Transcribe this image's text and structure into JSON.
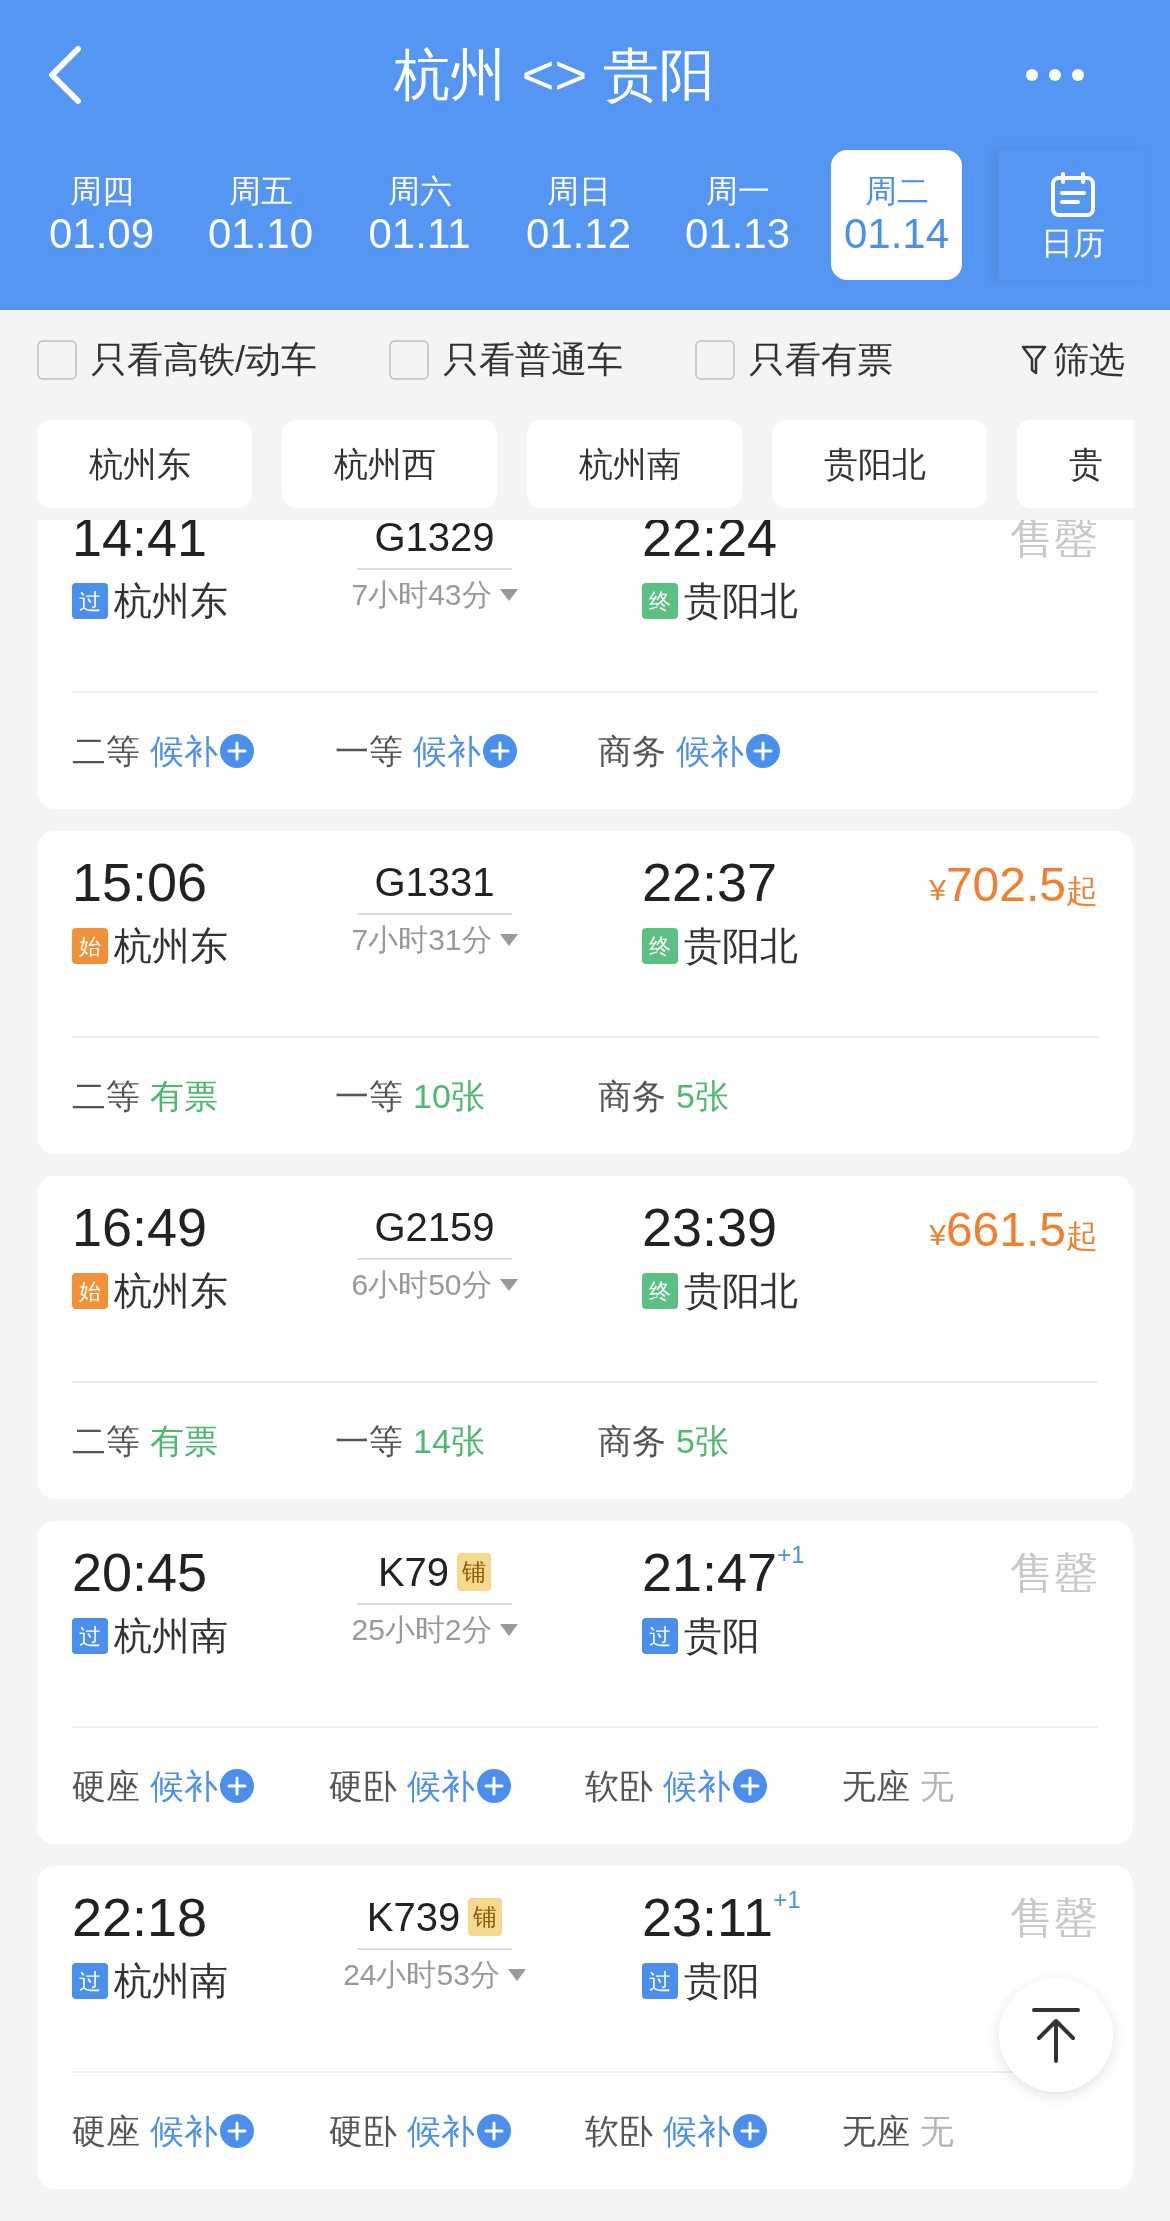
{
  "header": {
    "title": "杭州 <> 贵阳",
    "calendar_label": "日历"
  },
  "dates": [
    {
      "weekday": "周四",
      "date": "01.09",
      "selected": false
    },
    {
      "weekday": "周五",
      "date": "01.10",
      "selected": false
    },
    {
      "weekday": "周六",
      "date": "01.11",
      "selected": false
    },
    {
      "weekday": "周日",
      "date": "01.12",
      "selected": false
    },
    {
      "weekday": "周一",
      "date": "01.13",
      "selected": false
    },
    {
      "weekday": "周二",
      "date": "01.14",
      "selected": true
    }
  ],
  "filters": [
    {
      "label": "只看高铁/动车",
      "checked": false
    },
    {
      "label": "只看普通车",
      "checked": false
    },
    {
      "label": "只看有票",
      "checked": false
    }
  ],
  "filter_button": "筛选",
  "stations": [
    "杭州东",
    "杭州西",
    "杭州南",
    "贵阳北",
    "贵"
  ],
  "trains": [
    {
      "depart": "14:41",
      "train_no": "G1329",
      "duration": "7小时43分",
      "arrive": "22:24",
      "from": {
        "tag": "过",
        "kind": "pass",
        "name": "杭州东"
      },
      "to": {
        "tag": "终",
        "kind": "terminal",
        "name": "贵阳北"
      },
      "status": "售罄",
      "seats": [
        {
          "class": "二等",
          "availability": "候补",
          "kind": "waitlist"
        },
        {
          "class": "一等",
          "availability": "候补",
          "kind": "waitlist"
        },
        {
          "class": "商务",
          "availability": "候补",
          "kind": "waitlist"
        }
      ]
    },
    {
      "depart": "15:06",
      "train_no": "G1331",
      "duration": "7小时31分",
      "arrive": "22:37",
      "from": {
        "tag": "始",
        "kind": "origin",
        "name": "杭州东"
      },
      "to": {
        "tag": "终",
        "kind": "terminal",
        "name": "贵阳北"
      },
      "price": {
        "currency": "¥",
        "amount": "702.5",
        "suffix": "起"
      },
      "seats": [
        {
          "class": "二等",
          "availability": "有票",
          "kind": "available"
        },
        {
          "class": "一等",
          "availability": "10张",
          "kind": "available"
        },
        {
          "class": "商务",
          "availability": "5张",
          "kind": "available"
        }
      ]
    },
    {
      "depart": "16:49",
      "train_no": "G2159",
      "duration": "6小时50分",
      "arrive": "23:39",
      "from": {
        "tag": "始",
        "kind": "origin",
        "name": "杭州东"
      },
      "to": {
        "tag": "终",
        "kind": "terminal",
        "name": "贵阳北"
      },
      "price": {
        "currency": "¥",
        "amount": "661.5",
        "suffix": "起"
      },
      "seats": [
        {
          "class": "二等",
          "availability": "有票",
          "kind": "available"
        },
        {
          "class": "一等",
          "availability": "14张",
          "kind": "available"
        },
        {
          "class": "商务",
          "availability": "5张",
          "kind": "available"
        }
      ]
    },
    {
      "depart": "20:45",
      "train_no": "K79",
      "berth_badge": "铺",
      "duration": "25小时2分",
      "arrive": "21:47",
      "next_day": "+1",
      "from": {
        "tag": "过",
        "kind": "pass",
        "name": "杭州南"
      },
      "to": {
        "tag": "过",
        "kind": "pass",
        "name": "贵阳"
      },
      "status": "售罄",
      "seats": [
        {
          "class": "硬座",
          "availability": "候补",
          "kind": "waitlist"
        },
        {
          "class": "硬卧",
          "availability": "候补",
          "kind": "waitlist"
        },
        {
          "class": "软卧",
          "availability": "候补",
          "kind": "waitlist"
        },
        {
          "class": "无座",
          "availability": "无",
          "kind": "none"
        }
      ]
    },
    {
      "depart": "22:18",
      "train_no": "K739",
      "berth_badge": "铺",
      "duration": "24小时53分",
      "arrive": "23:11",
      "next_day": "+1",
      "from": {
        "tag": "过",
        "kind": "pass",
        "name": "杭州南"
      },
      "to": {
        "tag": "过",
        "kind": "pass",
        "name": "贵阳"
      },
      "status": "售罄",
      "seats": [
        {
          "class": "硬座",
          "availability": "候补",
          "kind": "waitlist"
        },
        {
          "class": "硬卧",
          "availability": "候补",
          "kind": "waitlist"
        },
        {
          "class": "软卧",
          "availability": "候补",
          "kind": "waitlist"
        },
        {
          "class": "无座",
          "availability": "无",
          "kind": "none"
        }
      ]
    }
  ]
}
